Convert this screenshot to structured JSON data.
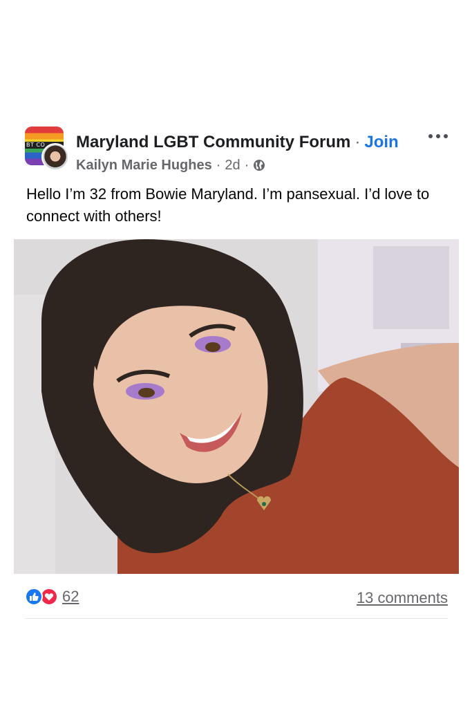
{
  "group": {
    "name": "Maryland LGBT Community Forum",
    "join_label": "Join",
    "avatar_band_text": "BT CO"
  },
  "post": {
    "author": "Kailyn Marie Hughes",
    "time": "2d",
    "separator": "·",
    "audience_icon": "globe-icon",
    "text": "Hello I’m 32 from Bowie Maryland. I’m pansexual. I’d love to connect with others!",
    "photo_icon": "selfie-photo"
  },
  "footer": {
    "reactions": [
      "like-icon",
      "love-icon"
    ],
    "reaction_count": "62",
    "comments_label": "13 comments"
  },
  "colors": {
    "join": "#1b74e4",
    "like": "#1877f2",
    "love": "#f02849",
    "secondary_text": "#65676b"
  }
}
